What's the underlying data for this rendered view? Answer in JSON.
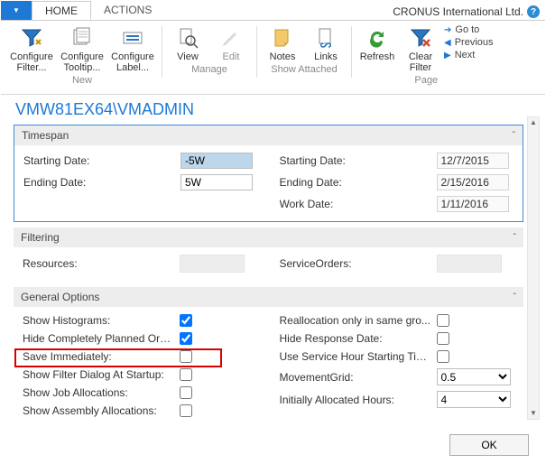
{
  "tabs": {
    "dropdown_glyph": "▼",
    "home": "HOME",
    "actions": "ACTIONS"
  },
  "company_label": "CRONUS International Ltd.",
  "ribbon": {
    "configure_filter": "Configure Filter...",
    "configure_tooltip": "Configure Tooltip...",
    "configure_label": "Configure Label...",
    "group_new": "New",
    "view": "View",
    "edit": "Edit",
    "group_manage": "Manage",
    "notes": "Notes",
    "links": "Links",
    "group_attached": "Show Attached",
    "refresh": "Refresh",
    "clear_filter": "Clear Filter",
    "goto": "Go to",
    "previous": "Previous",
    "next": "Next",
    "group_page": "Page"
  },
  "path_title": "VMW81EX64\\VMADMIN",
  "timespan": {
    "header": "Timespan",
    "left": {
      "starting_label": "Starting Date:",
      "starting_value": "-5W",
      "ending_label": "Ending Date:",
      "ending_value": "5W"
    },
    "right": {
      "starting_label": "Starting Date:",
      "starting_value": "12/7/2015",
      "ending_label": "Ending Date:",
      "ending_value": "2/15/2016",
      "work_label": "Work Date:",
      "work_value": "1/11/2016"
    }
  },
  "filtering": {
    "header": "Filtering",
    "resources_label": "Resources:",
    "service_orders_label": "ServiceOrders:"
  },
  "general": {
    "header": "General Options",
    "left": {
      "show_histograms": "Show Histograms:",
      "hide_planned": "Hide Completely Planned Ord...",
      "save_immediately": "Save Immediately:",
      "show_filter_dialog": "Show Filter Dialog At Startup:",
      "show_job_alloc": "Show Job Allocations:",
      "show_assembly_alloc": "Show Assembly Allocations:"
    },
    "right": {
      "realloc_same_group": "Reallocation only in same gro...",
      "hide_response_date": "Hide Response Date:",
      "use_service_hour": "Use Service Hour Starting Tim...",
      "movement_grid_label": "MovementGrid:",
      "movement_grid_value": "0.5",
      "initially_alloc_label": "Initially Allocated Hours:",
      "initially_alloc_value": "4"
    }
  },
  "ok_button": "OK"
}
